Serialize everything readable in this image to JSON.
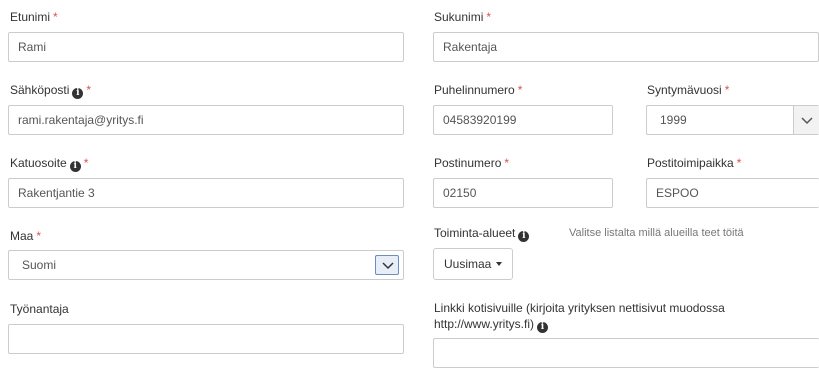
{
  "form": {
    "first_name": {
      "label": "Etunimi",
      "required": "*",
      "value": "Rami"
    },
    "last_name": {
      "label": "Sukunimi",
      "required": "*",
      "value": "Rakentaja"
    },
    "email": {
      "label": "Sähköposti",
      "required": "*",
      "value": "rami.rakentaja@yritys.fi",
      "info_icon": "info-circle-icon"
    },
    "phone": {
      "label": "Puhelinnumero",
      "required": "*",
      "value": "04583920199"
    },
    "birth_year": {
      "label": "Syntymävuosi",
      "required": "*",
      "value": "1999",
      "caret_icon": "chevron-down-icon"
    },
    "street_address": {
      "label": "Katuosoite",
      "required": "*",
      "value": "Rakentjantie 3",
      "info_icon": "info-circle-icon"
    },
    "postal_code": {
      "label": "Postinumero",
      "required": "*",
      "value": "02150"
    },
    "city": {
      "label": "Postitoimipaikka",
      "required": "*",
      "value": "ESPOO"
    },
    "country": {
      "label": "Maa",
      "required": "*",
      "value": "Suomi",
      "caret_icon": "chevron-down-icon"
    },
    "service_areas": {
      "label": "Toiminta-alueet",
      "hint": "Valitse listalta millä alueilla teet töitä",
      "button_label": "Uusimaa",
      "info_icon": "info-circle-icon"
    },
    "employer": {
      "label": "Työnantaja",
      "value": ""
    },
    "website": {
      "label": "Linkki kotisivuille (kirjoita yrityksen nettisivut muodossa http://www.yritys.fi)",
      "value": "",
      "info_icon": "info-circle-icon"
    }
  },
  "colors": {
    "required_marker": "#d9534f",
    "field_border": "#cccccc",
    "select_caret_border": "#6c8dbd",
    "text": "#333333"
  }
}
